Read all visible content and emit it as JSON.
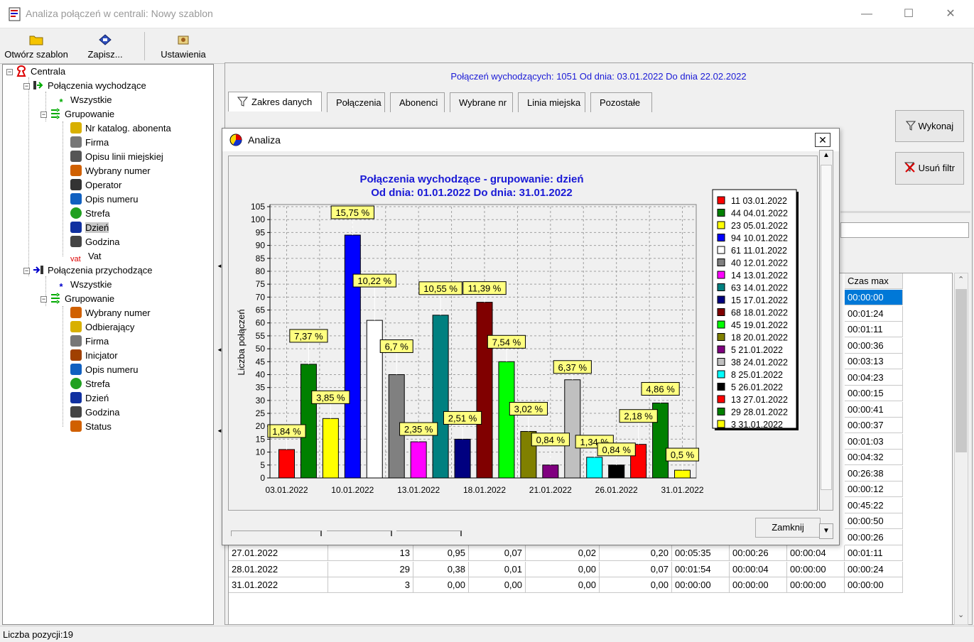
{
  "window": {
    "title": "Analiza połączeń w centrali: Nowy szablon",
    "minimize_glyph": "—",
    "maximize_glyph": "☐",
    "close_glyph": "✕"
  },
  "toolbar": {
    "open_label": "Otwórz szablon",
    "save_label": "Zapisz...",
    "settings_label": "Ustawienia"
  },
  "tree": {
    "root": "Centrala",
    "outgoing": "Połączenia wychodzące",
    "out_all": "Wszystkie",
    "out_group": "Grupowanie",
    "out_items": [
      "Nr katalog. abonenta",
      "Firma",
      "Opisu linii miejskiej",
      "Wybrany numer",
      "Operator",
      "Opis numeru",
      "Strefa",
      "Dzień",
      "Godzina",
      "Vat"
    ],
    "incoming": "Połączenia przychodzące",
    "in_all": "Wszystkie",
    "in_group": "Grupowanie",
    "in_items": [
      "Wybrany numer",
      "Odbierający",
      "Firma",
      "Inicjator",
      "Opis numeru",
      "Strefa",
      "Dzień",
      "Godzina",
      "Status"
    ],
    "vat_icon_text": "vat"
  },
  "info": "Połączeń wychodzących: 1051 Od dnia: 03.01.2022 Do dnia 22.02.2022",
  "tabs": [
    "Zakres danych",
    "Połączenia",
    "Abonenci",
    "Wybrane nr",
    "Linia miejska",
    "Pozostałe"
  ],
  "buttons": {
    "execute": "Wykonaj",
    "remove_filter": "Usuń filtr"
  },
  "grid": {
    "header_last": "Czas max",
    "czas_max": [
      "00:00:00",
      "00:01:24",
      "00:01:11",
      "00:00:36",
      "00:03:13",
      "00:04:23",
      "00:00:15",
      "00:00:41",
      "00:00:37",
      "00:01:03",
      "00:04:32",
      "00:26:38",
      "00:00:12",
      "00:45:22",
      "00:00:50",
      "00:00:26",
      "00:01:11",
      "00:00:24",
      "00:00:00"
    ],
    "rows": [
      [
        "27.01.2022",
        "13",
        "0,95",
        "0,07",
        "0,02",
        "0,20",
        "00:05:35",
        "00:00:26",
        "00:00:04"
      ],
      [
        "28.01.2022",
        "29",
        "0,38",
        "0,01",
        "0,00",
        "0,07",
        "00:01:54",
        "00:00:04",
        "00:00:00"
      ],
      [
        "31.01.2022",
        "3",
        "0,00",
        "0,00",
        "0,00",
        "0,00",
        "00:00:00",
        "00:00:00",
        "00:00:00"
      ]
    ]
  },
  "status": "Liczba pozycji:19",
  "dialog": {
    "title": "Analiza",
    "close_button": "Zamknij",
    "close_glyph": "✕"
  },
  "chart_data": {
    "type": "bar",
    "title": "Połączenia wychodzące - grupowanie: dzień",
    "subtitle": "Od dnia: 01.01.2022 Do dnia: 31.01.2022",
    "ylabel": "Liczba połączeń",
    "xlabel": "",
    "ylim": [
      0,
      105
    ],
    "yticks": [
      0,
      5,
      10,
      15,
      20,
      25,
      30,
      35,
      40,
      45,
      50,
      55,
      60,
      65,
      70,
      75,
      80,
      85,
      90,
      95,
      100,
      105
    ],
    "xtick_labels": [
      "03.01.2022",
      "10.01.2022",
      "13.01.2022",
      "18.01.2022",
      "21.01.2022",
      "26.01.2022",
      "31.01.2022"
    ],
    "grid": true,
    "legend": "right",
    "categories": [
      "03.01.2022",
      "04.01.2022",
      "05.01.2022",
      "10.01.2022",
      "11.01.2022",
      "12.01.2022",
      "13.01.2022",
      "14.01.2022",
      "17.01.2022",
      "18.01.2022",
      "19.01.2022",
      "20.01.2022",
      "21.01.2022",
      "24.01.2022",
      "25.01.2022",
      "26.01.2022",
      "27.01.2022",
      "28.01.2022",
      "31.01.2022"
    ],
    "values": [
      11,
      44,
      23,
      94,
      61,
      40,
      14,
      63,
      15,
      68,
      45,
      18,
      5,
      38,
      8,
      5,
      13,
      29,
      3
    ],
    "percent_labels": [
      "1,84 %",
      "7,37 %",
      "3,85 %",
      "15,75 %",
      "10,22 %",
      "6,7 %",
      "2,35 %",
      "10,55 %",
      "2,51 %",
      "11,39 %",
      "7,54 %",
      "3,02 %",
      "0,84 %",
      "6,37 %",
      "1,34 %",
      "0,84 %",
      "2,18 %",
      "4,86 %",
      "0,5 %"
    ],
    "legend_entries": [
      "11 03.01.2022",
      "44 04.01.2022",
      "23 05.01.2022",
      "94 10.01.2022",
      "61 11.01.2022",
      "40 12.01.2022",
      "14 13.01.2022",
      "63 14.01.2022",
      "15 17.01.2022",
      "68 18.01.2022",
      "45 19.01.2022",
      "18 20.01.2022",
      "5 21.01.2022",
      "38 24.01.2022",
      "8 25.01.2022",
      "5 26.01.2022",
      "13 27.01.2022",
      "29 28.01.2022",
      "3 31.01.2022"
    ],
    "colors": [
      "#ff0000",
      "#008000",
      "#ffff00",
      "#0000ff",
      "#ffffff",
      "#808080",
      "#ff00ff",
      "#008080",
      "#000080",
      "#800000",
      "#00ff00",
      "#808000",
      "#800080",
      "#c0c0c0",
      "#00ffff",
      "#000000",
      "#ff0000",
      "#008000",
      "#ffff00"
    ]
  }
}
